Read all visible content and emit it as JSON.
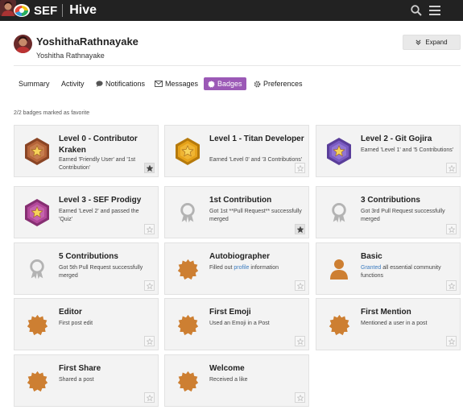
{
  "app": {
    "logo_text": "SEF",
    "name": "Hive"
  },
  "colors": {
    "topbar": "#222222",
    "accent": "#9b59b6",
    "bronze": "#cd7f32",
    "silver": "#aaaaaa",
    "link": "#3b7bbf"
  },
  "topbar_icons": [
    "search-icon",
    "hamburger-menu-icon",
    "user-avatar"
  ],
  "profile": {
    "username": "YoshithaRathnayake",
    "fullname": "Yoshitha Rathnayake",
    "expand_label": "Expand"
  },
  "nav": {
    "summary": "Summary",
    "activity": "Activity",
    "notifications": "Notifications",
    "messages": "Messages",
    "badges": "Badges",
    "preferences": "Preferences",
    "active": "Badges"
  },
  "favorites_note": "2/2 badges marked as favorite",
  "badges": [
    {
      "title": "Level 0 - Contributor Kraken",
      "desc": "Earned 'Friendly User' and '1st Contribution'",
      "icon": "hexagon-star-bronze",
      "favorite": true
    },
    {
      "title": "Level 1 - Titan Developer",
      "desc": "Earned 'Level 0' and '3 Contributions'",
      "icon": "hexagon-star-gold",
      "favorite": false
    },
    {
      "title": "Level 2 - Git Gojira",
      "desc": "Earned 'Level 1' and '5 Contributions'",
      "icon": "hexagon-star-purple",
      "favorite": false
    },
    {
      "title": "Level 3 - SEF Prodigy",
      "desc": "Earned 'Level 2' and passed the 'Quiz'",
      "icon": "hexagon-star-pink",
      "favorite": false
    },
    {
      "title": "1st Contribution",
      "desc": "Got 1st **Pull Request** successfully merged",
      "icon": "award-ribbon-silver",
      "favorite": true
    },
    {
      "title": "3 Contributions",
      "desc": "Got 3rd Pull Request successfully merged",
      "icon": "award-ribbon-silver",
      "favorite": false
    },
    {
      "title": "5 Contributions",
      "desc": "Got 5th Pull Request successfully merged",
      "icon": "award-ribbon-silver",
      "favorite": false
    },
    {
      "title": "Autobiographer",
      "desc_before": "Filled out ",
      "desc_link": "profile",
      "desc_after": " information",
      "icon": "certificate-bronze",
      "favorite": false
    },
    {
      "title": "Basic",
      "desc_link": "Granted",
      "desc_after": " all essential community functions",
      "icon": "user-bronze",
      "favorite": false
    },
    {
      "title": "Editor",
      "desc": "First post edit",
      "icon": "certificate-bronze",
      "favorite": false
    },
    {
      "title": "First Emoji",
      "desc": "Used an Emoji in a Post",
      "icon": "certificate-bronze",
      "favorite": false
    },
    {
      "title": "First Mention",
      "desc": "Mentioned a user in a post",
      "icon": "certificate-bronze",
      "favorite": false
    },
    {
      "title": "First Share",
      "desc": "Shared a post",
      "icon": "certificate-bronze",
      "favorite": false
    },
    {
      "title": "Welcome",
      "desc": "Received a like",
      "icon": "certificate-bronze",
      "favorite": false
    }
  ]
}
